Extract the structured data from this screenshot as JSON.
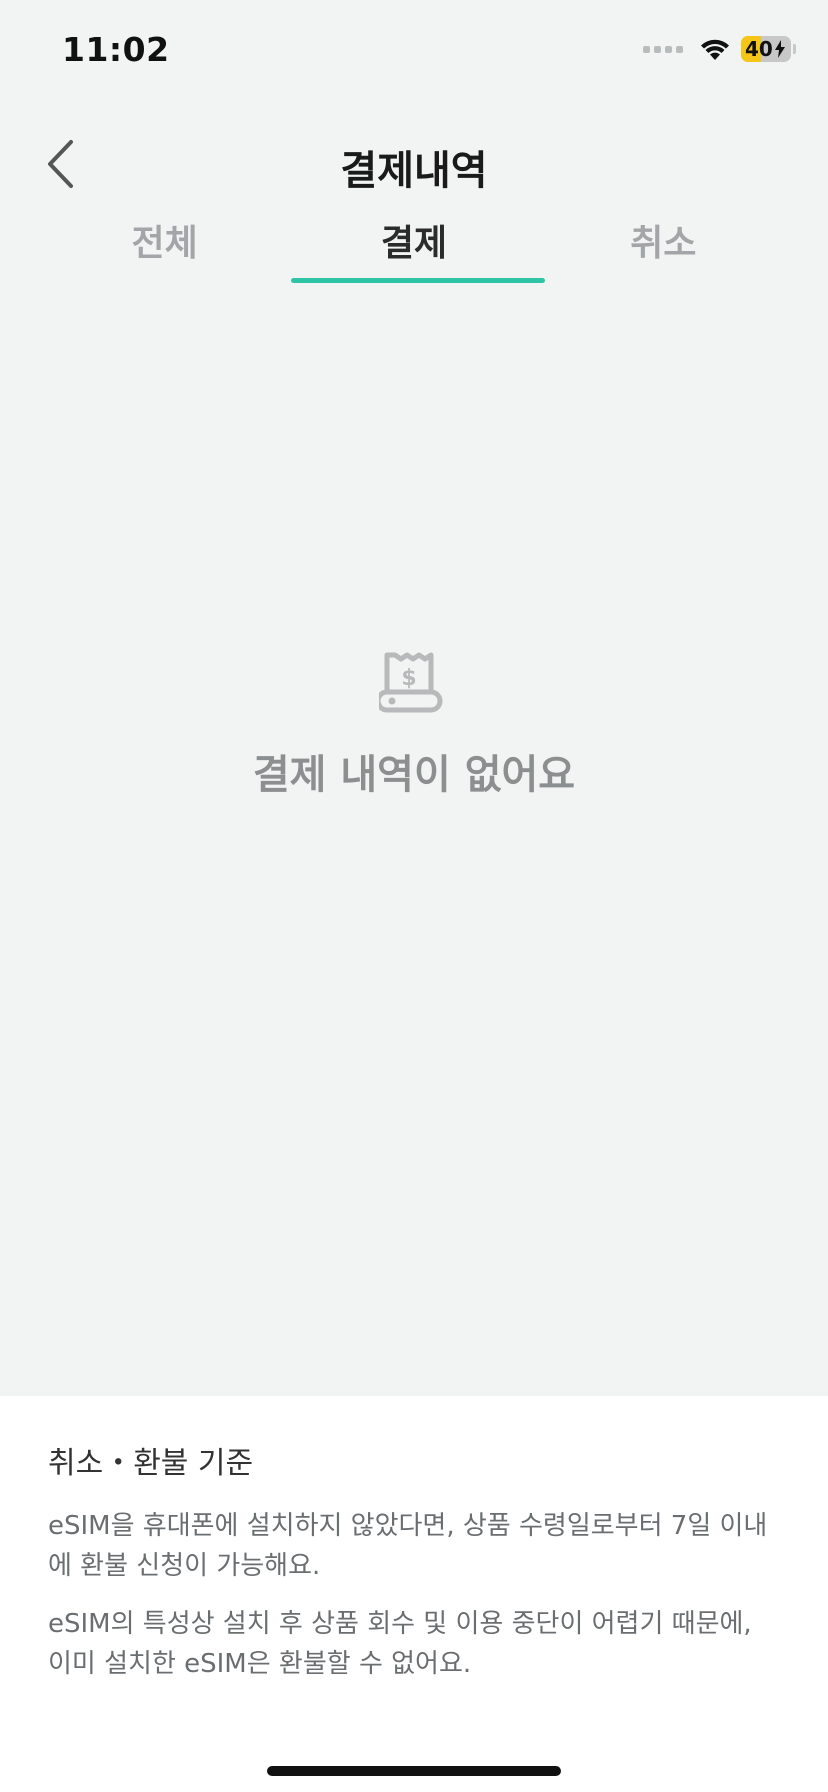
{
  "status_bar": {
    "time": "11:02",
    "battery": "40"
  },
  "header": {
    "title": "결제내역"
  },
  "tabs": [
    {
      "label": "전체",
      "active": false
    },
    {
      "label": "결제",
      "active": true
    },
    {
      "label": "취소",
      "active": false
    }
  ],
  "empty_state": {
    "message": "결제 내역이 없어요"
  },
  "policy": {
    "title": "취소・환불 기준",
    "paragraphs": [
      "eSIM을 휴대폰에 설치하지 않았다면, 상품 수령일로부터 7일 이내에 환불 신청이 가능해요.",
      "eSIM의 특성상 설치 후 상품 회수 및 이용 중단이 어렵기 때문에, 이미 설치한 eSIM은 환불할 수 없어요."
    ]
  },
  "colors": {
    "accent": "#2ec4a5",
    "battery": "#f5c518",
    "background": "#f2f4f3"
  },
  "icons": [
    "chevron-left-icon",
    "receipt-icon",
    "wifi-icon",
    "signal-icon",
    "battery-icon",
    "charging-icon"
  ]
}
